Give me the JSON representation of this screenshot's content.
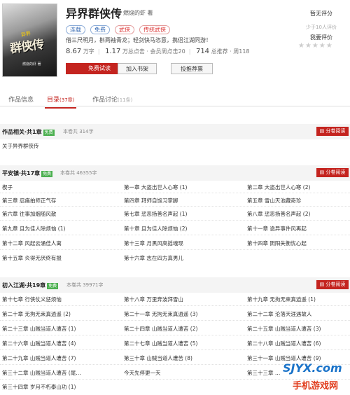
{
  "cover": {
    "sub": "异界",
    "main": "群侠传",
    "author": "燃烧的虾 著"
  },
  "book": {
    "title": "异界群侠传",
    "author": "燃烧的虾 著",
    "intro": "借三尺明月，斟两袖青龙；轻剑快马恣意，携侣江湖同游！"
  },
  "tags": [
    "连载",
    "免费",
    "武侠",
    "传统武侠"
  ],
  "stats": {
    "words_num": "8.67",
    "words_unit": "万字",
    "clicks_num": "1.17",
    "clicks_unit": "万总点击",
    "member_clicks": "会员周点击20",
    "rec_num": "714",
    "rec_unit": "总推荐",
    "week_rec": "周118"
  },
  "buttons": {
    "read": "免费试读",
    "shelf": "加入书架",
    "vote": "投推荐票"
  },
  "rating": {
    "title": "暂无评分",
    "count": "少于10人评价",
    "mine": "我要评价",
    "stars": "★★★★★"
  },
  "tabs": [
    {
      "label": "作品信息",
      "count": ""
    },
    {
      "label": "目录",
      "count": "(37章)"
    },
    {
      "label": "作品讨论",
      "count": "(11条)"
    }
  ],
  "volumes": [
    {
      "name": "作品相关·共1章",
      "badge": "免费",
      "words": "本卷共 314字",
      "download": "分卷阅读",
      "chapters": [
        "关于异界群侠传"
      ]
    },
    {
      "name": "平安镇·共17章",
      "badge": "免费",
      "words": "本卷共 46355字",
      "download": "分卷阅读",
      "chapters": [
        "楔子",
        "第一章 大盗出世人心寒 (1)",
        "第二章 大盗出世人心寒 (2)",
        "第三章 忍痛拍师正气存",
        "第四章 拜师自饱习掌脚",
        "第五章 雪山天池藏奇珍",
        "第六章 往事加烟随风散",
        "第七章 惩恶扬善名声起 (1)",
        "第八章 惩恶扬善名声起 (2)",
        "第九章 且为佳人除烦恼 (1)",
        "第十章 且为佳人除烦恼 (2)",
        "第十一章 诡异事件风再起",
        "第十二章 风起云涌佳人离",
        "第十三章 月黑风高摇魂现",
        "第十四章 阴阳失衡忧心起",
        "第十五章 炎得无厌终有报",
        "第十六章 志在四方真男儿"
      ]
    },
    {
      "name": "初入江湖·共19章",
      "badge": "免费",
      "words": "本卷共 39971字",
      "download": "分卷阅读",
      "chapters": [
        "第十七章 行侠仗义惩烦恼",
        "第十八章 万里奔波拜雪山",
        "第十九章 无拘无束真逍遥 (1)",
        "第二十章 无拘无束真逍遥 (2)",
        "第二十一章 无拘无束真逍遥 (3)",
        "第二十二章 沦落天涯遇故人",
        "第二十三章 山贼当道人遭苦 (1)",
        "第二十四章 山贼当道人遭苦 (2)",
        "第二十五章 山贼当道人遭苦 (3)",
        "第二十六章 山贼当道人遭苦 (4)",
        "第二十七章 山贼当道人遭苦 (5)",
        "第二十八章 山贼当道人遭苦 (6)",
        "第二十九章 山贼当道人遭苦 (7)",
        "第三十章 山贼当道人遭苦 (8)",
        "第三十一章 山贼当道人遭苦 (9)",
        "第三十二章 山贼当道人遭苦 (尾…",
        "今天先停更一天",
        "第三十三章 …",
        "第三十四章 岁月不朽泰山功 (1)"
      ]
    }
  ],
  "watermark": {
    "line1": "SJYX.com",
    "line2": "手机游戏网"
  }
}
